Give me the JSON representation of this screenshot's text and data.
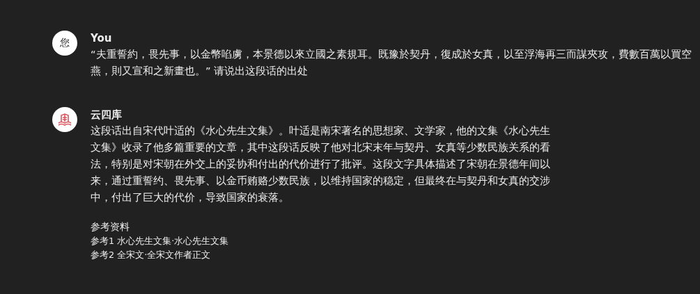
{
  "messages": [
    {
      "kind": "user",
      "avatar_text": "您",
      "author": "You",
      "paragraphs": [
        "“夫重誓約，畏先事，以金幣啗虜，本景德以來立國之素規耳。既豫於契丹，復成於女真，以至浮海再三而謀夾攻，費數百萬以買空燕，則又宣和之新畫也。” 请说出这段话的出处"
      ]
    },
    {
      "kind": "assistant",
      "author": "云四库",
      "paragraphs": [
        "这段话出自宋代叶适的《水心先生文集》。叶适是南宋著名的思想家、文学家，他的文集《水心先生文集》收录了他多篇重要的文章，其中这段话反映了他对北宋末年与契丹、女真等少数民族关系的看法，特别是对宋朝在外交上的妥协和付出的代价进行了批评。这段文字具体描述了宋朝在景德年间以来，通过重誓约、畏先事、以金币贿赂少数民族，以维持国家的稳定，但最终在与契丹和女真的交涉中，付出了巨大的代价，导致国家的衰落。"
      ],
      "references_title": "参考资料",
      "references": [
        {
          "label": "参考1",
          "text": "水心先生文集·水心先生文集"
        },
        {
          "label": "参考2",
          "text": "全宋文·全宋文作者正文"
        }
      ]
    }
  ]
}
